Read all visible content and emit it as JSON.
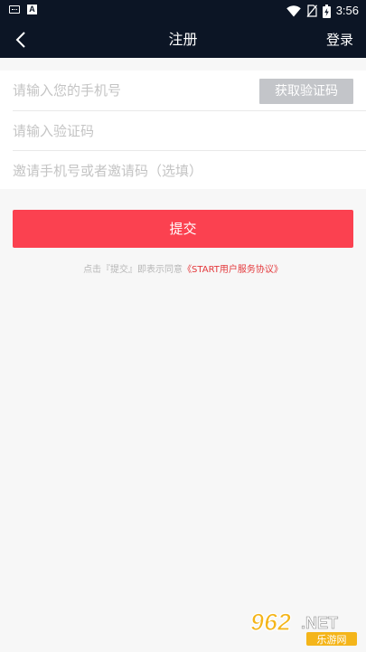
{
  "status_bar": {
    "time": "3:56",
    "icons": [
      "keyboard-icon",
      "a-icon",
      "wifi-icon",
      "no-sim-icon",
      "battery-charging-icon"
    ]
  },
  "nav": {
    "back_icon": "chevron-left-icon",
    "title": "注册",
    "login": "登录"
  },
  "form": {
    "phone_placeholder": "请输入您的手机号",
    "code_button": "获取验证码",
    "code_placeholder": "请输入验证码",
    "invite_placeholder": "邀请手机号或者邀请码（选填）"
  },
  "submit_label": "提交",
  "agreement": {
    "prefix": "点击『提交』即表示同意",
    "link": "《START用户服务协议》"
  },
  "watermark": {
    "number": "962",
    "suffix": ".NET",
    "caption": "乐游网"
  },
  "colors": {
    "header_bg": "#0c1525",
    "submit_bg": "#fb4150",
    "code_button_bg": "#c3c5c9",
    "link": "#e4393c"
  }
}
